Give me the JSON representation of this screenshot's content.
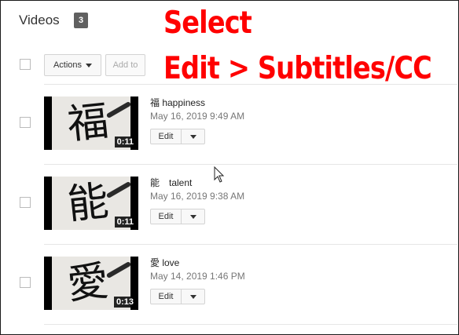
{
  "header": {
    "title": "Videos",
    "count": "3"
  },
  "annotation": {
    "line1": "Select",
    "line2": "Edit > Subtitles/CC",
    "color": "#ff0000"
  },
  "toolbar": {
    "actions_label": "Actions",
    "add_to_label": "Add to"
  },
  "videos": [
    {
      "title": "福 happiness",
      "date": "May 16, 2019 9:49 AM",
      "duration": "0:11",
      "glyph": "福",
      "edit_label": "Edit"
    },
    {
      "title": "能　talent",
      "date": "May 16, 2019 9:38 AM",
      "duration": "0:11",
      "glyph": "能",
      "edit_label": "Edit"
    },
    {
      "title": "愛 love",
      "date": "May 14, 2019 1:46 PM",
      "duration": "0:13",
      "glyph": "愛",
      "edit_label": "Edit"
    }
  ],
  "icons": {
    "dropdown": "chevron-down-icon",
    "cursor": "mouse-pointer-icon"
  }
}
